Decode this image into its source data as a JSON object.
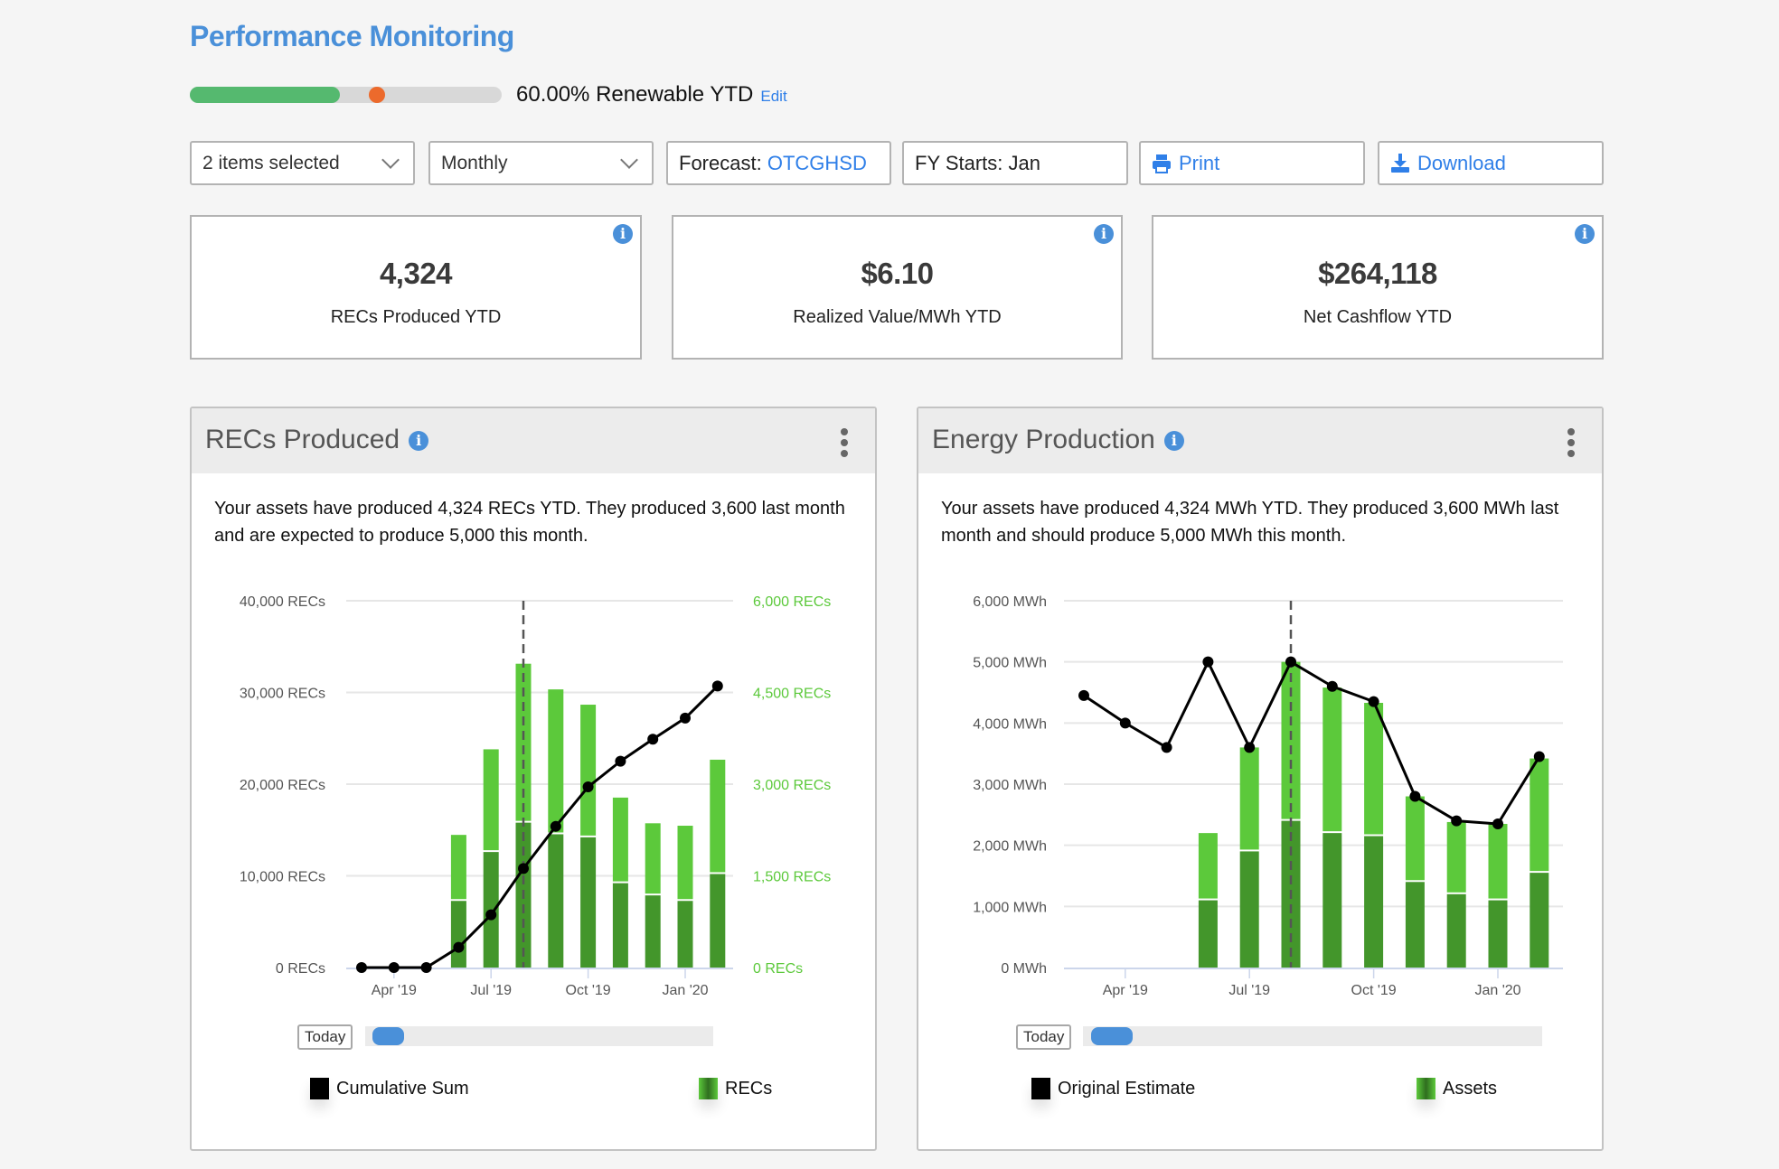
{
  "header": {
    "title": "Performance Monitoring",
    "renewable": {
      "text": "60.00% Renewable YTD",
      "edit_label": "Edit",
      "progress_fraction": 0.6,
      "target_fraction": 0.6,
      "fill_color": "#55b96f",
      "target_color": "#ec6a2c"
    }
  },
  "controls": {
    "items_select": "2 items selected",
    "period_select": "Monthly",
    "forecast_label": "Forecast:",
    "forecast_value": "OTCGHSD",
    "fy_starts": "FY Starts: Jan",
    "print_label": "Print",
    "download_label": "Download"
  },
  "kpis": [
    {
      "value": "4,324",
      "label": "RECs Produced YTD"
    },
    {
      "value": "$6.10",
      "label": "Realized Value/MWh YTD"
    },
    {
      "value": "$264,118",
      "label": "Net Cashflow YTD"
    }
  ],
  "panels": {
    "recs": {
      "title": "RECs Produced",
      "description": "Your assets have produced 4,324 RECs YTD. They produced 3,600 last month and are expected to produce 5,000 this month.",
      "today_label": "Today",
      "legend": [
        "Cumulative Sum",
        "RECs"
      ]
    },
    "energy": {
      "title": "Energy Production",
      "description": "Your assets have produced 4,324 MWh YTD. They produced 3,600 MWh last month and should produce 5,000 MWh this month.",
      "today_label": "Today",
      "legend": [
        "Original Estimate",
        "Assets"
      ]
    }
  },
  "colors": {
    "accent": "#4a90d9",
    "link": "#2f7fe8",
    "bar_dark": "#43962b",
    "bar_light": "#5cc93b",
    "line": "#000000"
  },
  "chart_data": [
    {
      "type": "bar+line",
      "x": [
        "Mar '19",
        "Apr '19",
        "May '19",
        "Jun '19",
        "Jul '19",
        "Aug '19",
        "Sep '19",
        "Oct '19",
        "Nov '19",
        "Dec '19",
        "Jan '20",
        "Feb '20"
      ],
      "x_tick_labels": [
        "Apr '19",
        "Jul '19",
        "Oct '19",
        "Jan '20"
      ],
      "today_marker": "Aug '19",
      "y_left": {
        "range": [
          0,
          40000
        ],
        "ticks": [
          "0 RECs",
          "10,000 RECs",
          "20,000 RECs",
          "30,000 RECs",
          "40,000 RECs"
        ]
      },
      "y_right": {
        "range": [
          0,
          6000
        ],
        "ticks": [
          "0 RECs",
          "1,500 RECs",
          "3,000 RECs",
          "4,500 RECs",
          "6,000 RECs"
        ],
        "color": "#5cc93b"
      },
      "grid": true,
      "legend_position": "bottom",
      "series": [
        {
          "name": "Cumulative Sum",
          "type": "line",
          "axis": "left",
          "values": [
            0,
            0,
            0,
            2200,
            5750,
            10800,
            15400,
            19700,
            22500,
            24900,
            27200,
            30700
          ]
        },
        {
          "name": "RECs",
          "type": "stacked-bar",
          "axis": "right",
          "stack": [
            {
              "values": [
                null,
                null,
                null,
                1090,
                1890,
                2370,
                2180,
                2130,
                1380,
                1180,
                1090,
                1530
              ]
            },
            {
              "values": [
                null,
                null,
                null,
                1080,
                1680,
                2600,
                2370,
                2170,
                1400,
                1180,
                1230,
                1870
              ]
            }
          ]
        }
      ]
    },
    {
      "type": "bar+line",
      "x": [
        "Mar '19",
        "Apr '19",
        "May '19",
        "Jun '19",
        "Jul '19",
        "Aug '19",
        "Sep '19",
        "Oct '19",
        "Nov '19",
        "Dec '19",
        "Jan '20",
        "Feb '20"
      ],
      "x_tick_labels": [
        "Apr '19",
        "Jul '19",
        "Oct '19",
        "Jan '20"
      ],
      "today_marker": "Aug '19",
      "y_left": {
        "range": [
          0,
          6000
        ],
        "ticks": [
          "0 MWh",
          "1,000 MWh",
          "2,000 MWh",
          "3,000 MWh",
          "4,000 MWh",
          "5,000 MWh",
          "6,000 MWh"
        ]
      },
      "grid": true,
      "legend_position": "bottom",
      "series": [
        {
          "name": "Original Estimate",
          "type": "line",
          "axis": "left",
          "values": [
            4450,
            4000,
            3600,
            5000,
            3600,
            5000,
            4600,
            4350,
            2800,
            2400,
            2350,
            3450
          ]
        },
        {
          "name": "Assets",
          "type": "stacked-bar",
          "axis": "left",
          "stack": [
            {
              "values": [
                null,
                null,
                null,
                1100,
                1900,
                2400,
                2200,
                2150,
                1400,
                1200,
                1100,
                1550
              ]
            },
            {
              "values": [
                null,
                null,
                null,
                1100,
                1700,
                2600,
                2380,
                2180,
                1400,
                1180,
                1250,
                1870
              ]
            }
          ]
        }
      ]
    }
  ]
}
